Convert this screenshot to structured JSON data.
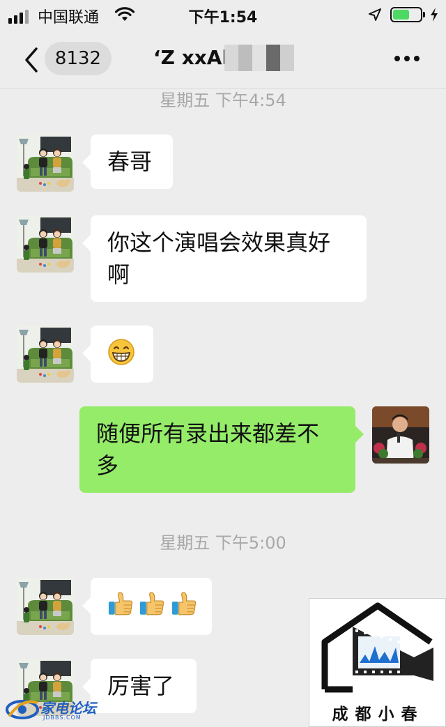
{
  "status_bar": {
    "carrier": "中国联通",
    "time": "下午1:54",
    "battery_level": 0.6
  },
  "nav": {
    "unread_count": "8132",
    "title": "‘Z xxAl"
  },
  "timestamps": [
    "星期五 下午4:54",
    "星期五 下午5:00"
  ],
  "messages": [
    {
      "direction": "in",
      "text": "春哥"
    },
    {
      "direction": "in",
      "text_line1": "你这个演唱会效果真好",
      "text_line2": "啊"
    },
    {
      "direction": "in",
      "emoji": "grinning-face-emoji"
    },
    {
      "direction": "out",
      "text_line1": "随便所有录出来都差不",
      "text_line2": "多"
    },
    {
      "direction": "in",
      "emoji": "thumbs-up-emoji",
      "count": 3
    },
    {
      "direction": "in",
      "text": "厉害了"
    }
  ],
  "watermarks": {
    "house_logo_text": "成都小春",
    "forum_logo_text": "家电论坛",
    "forum_logo_sub": "JDBBS.COM"
  },
  "colors": {
    "background": "#ededed",
    "incoming_bubble": "#ffffff",
    "outgoing_bubble": "#95ec69",
    "battery": "#4cd964"
  }
}
